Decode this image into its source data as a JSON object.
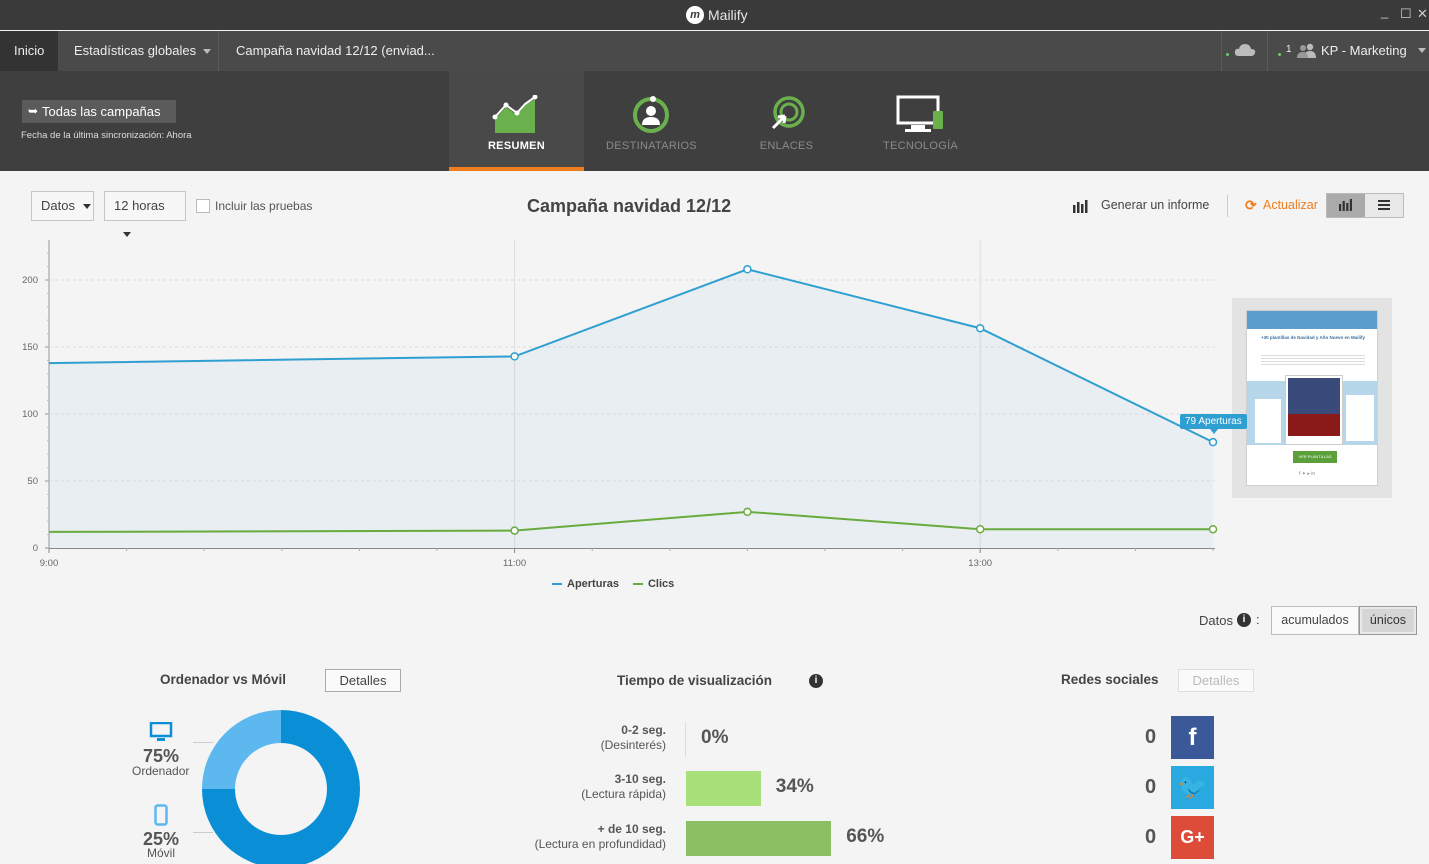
{
  "app": {
    "title": "Mailify",
    "logo_letter": "m"
  },
  "window": {
    "minimize": "_",
    "maximize": "☐",
    "close": "✕"
  },
  "breadcrumb": {
    "home": "Inicio",
    "stats": "Estadísticas globales",
    "campaign": "Campaña navidad 12/12 (enviad..."
  },
  "user": {
    "count": "1",
    "name": "KP - Marketing"
  },
  "header": {
    "back_label": "Todas las campañas",
    "sync_text": "Fecha de la última sincronización: Ahora",
    "tabs": [
      {
        "label": "RESUMEN",
        "icon": "line-chart-icon",
        "active": true
      },
      {
        "label": "DESTINATARIOS",
        "icon": "recipients-icon",
        "active": false
      },
      {
        "label": "ENLACES",
        "icon": "link-click-icon",
        "active": false
      },
      {
        "label": "TECNOLOGÍA",
        "icon": "devices-icon",
        "active": false
      }
    ]
  },
  "toolbar": {
    "datos_select": "Datos",
    "range_select": "12 horas",
    "include_tests": "Incluir las pruebas",
    "heading": "Campaña navidad 12/12",
    "report_label": "Generar un informe",
    "refresh_label": "Actualizar"
  },
  "chart_data": {
    "type": "area",
    "x": [
      "9:00",
      "11:00",
      "12:00",
      "13:00",
      "14:00"
    ],
    "x_hours": [
      9,
      11,
      12,
      13,
      14
    ],
    "x_tick_labels": [
      "9:00",
      "11:00",
      "13:00"
    ],
    "series": [
      {
        "name": "Aperturas",
        "color": "#2f9fd1",
        "values": [
          138,
          143,
          208,
          164,
          79
        ]
      },
      {
        "name": "Clics",
        "color": "#6aab3f",
        "values": [
          12,
          13,
          27,
          14,
          14
        ]
      }
    ],
    "ylim": [
      0,
      225
    ],
    "y_ticks": [
      0,
      50,
      100,
      150,
      200
    ],
    "grid": true,
    "legend": "bottom-center",
    "tooltip": "79 Aperturas"
  },
  "datos_toggle": {
    "label": "Datos",
    "colon": ":",
    "options": [
      "acumulados",
      "únicos"
    ],
    "selected": "únicos"
  },
  "devices": {
    "title": "Ordenador vs Móvil",
    "details": "Detalles",
    "desktop": {
      "pct": "75%",
      "label": "Ordenador",
      "value": 75,
      "color": "#0a8fd6"
    },
    "mobile": {
      "pct": "25%",
      "label": "Móvil",
      "value": 25,
      "color": "#5cb8ef"
    }
  },
  "view_time": {
    "title": "Tiempo de visualización",
    "rows": [
      {
        "range": "0-2 seg.",
        "desc": "(Desinterés)",
        "pct": "0%",
        "value": 0,
        "color": "#a8e07a"
      },
      {
        "range": "3-10 seg.",
        "desc": "(Lectura rápida)",
        "pct": "34%",
        "value": 34,
        "color": "#a8e07a"
      },
      {
        "range": "+ de 10 seg.",
        "desc": "(Lectura en profundidad)",
        "pct": "66%",
        "value": 66,
        "color": "#8cbf63"
      }
    ]
  },
  "social": {
    "title": "Redes sociales",
    "details": "Detalles",
    "networks": [
      {
        "name": "facebook",
        "count": "0",
        "glyph": "f",
        "color": "#3b5998"
      },
      {
        "name": "twitter",
        "count": "0",
        "glyph": "🐦",
        "color": "#2aa9e0"
      },
      {
        "name": "google-plus",
        "count": "0",
        "glyph": "G+",
        "color": "#dd4b39"
      }
    ]
  },
  "preview": {
    "heading": "+30 plantillas de Navidad y Año Nuevo en Mailify",
    "button": "VER PLANTILLAS"
  }
}
